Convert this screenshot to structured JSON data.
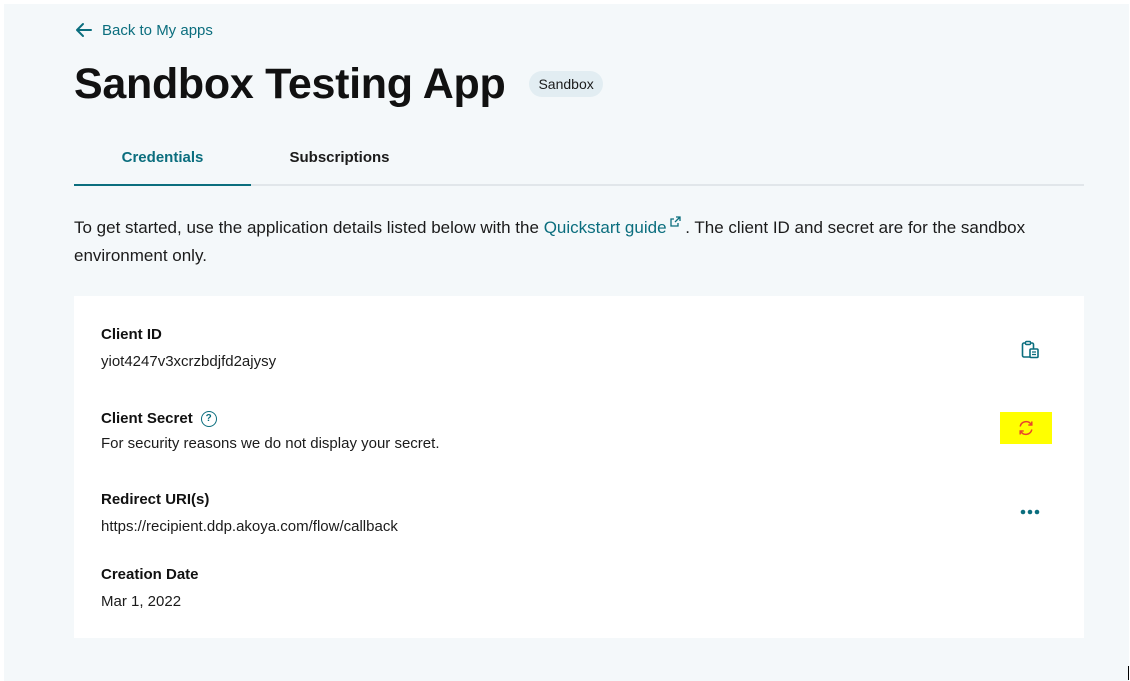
{
  "nav": {
    "back_label": "Back to My apps"
  },
  "header": {
    "title": "Sandbox Testing App",
    "badge": "Sandbox"
  },
  "tabs": [
    {
      "label": "Credentials",
      "active": true
    },
    {
      "label": "Subscriptions",
      "active": false
    }
  ],
  "intro": {
    "before_link": "To get started, use the application details listed below with the",
    "link_text": "Quickstart guide",
    "after_link": ". The client ID and secret are for the sandbox environment only."
  },
  "credentials": {
    "client_id": {
      "label": "Client ID",
      "value": "yiot4247v3xcrzbdjfd2ajysy",
      "action_icon": "copy-icon"
    },
    "client_secret": {
      "label": "Client Secret",
      "value": "For security reasons we do not display your secret.",
      "action_icon": "refresh-icon",
      "highlight_color": "#ffff00"
    },
    "redirect_uris": {
      "label": "Redirect URI(s)",
      "value": "https://recipient.ddp.akoya.com/flow/callback",
      "action_icon": "more-options-icon"
    },
    "creation_date": {
      "label": "Creation Date",
      "value": "Mar 1, 2022"
    }
  },
  "colors": {
    "accent": "#0b6e7e",
    "page_bg": "#f4f8fa",
    "card_bg": "#ffffff",
    "refresh_icon": "#e8452c"
  }
}
